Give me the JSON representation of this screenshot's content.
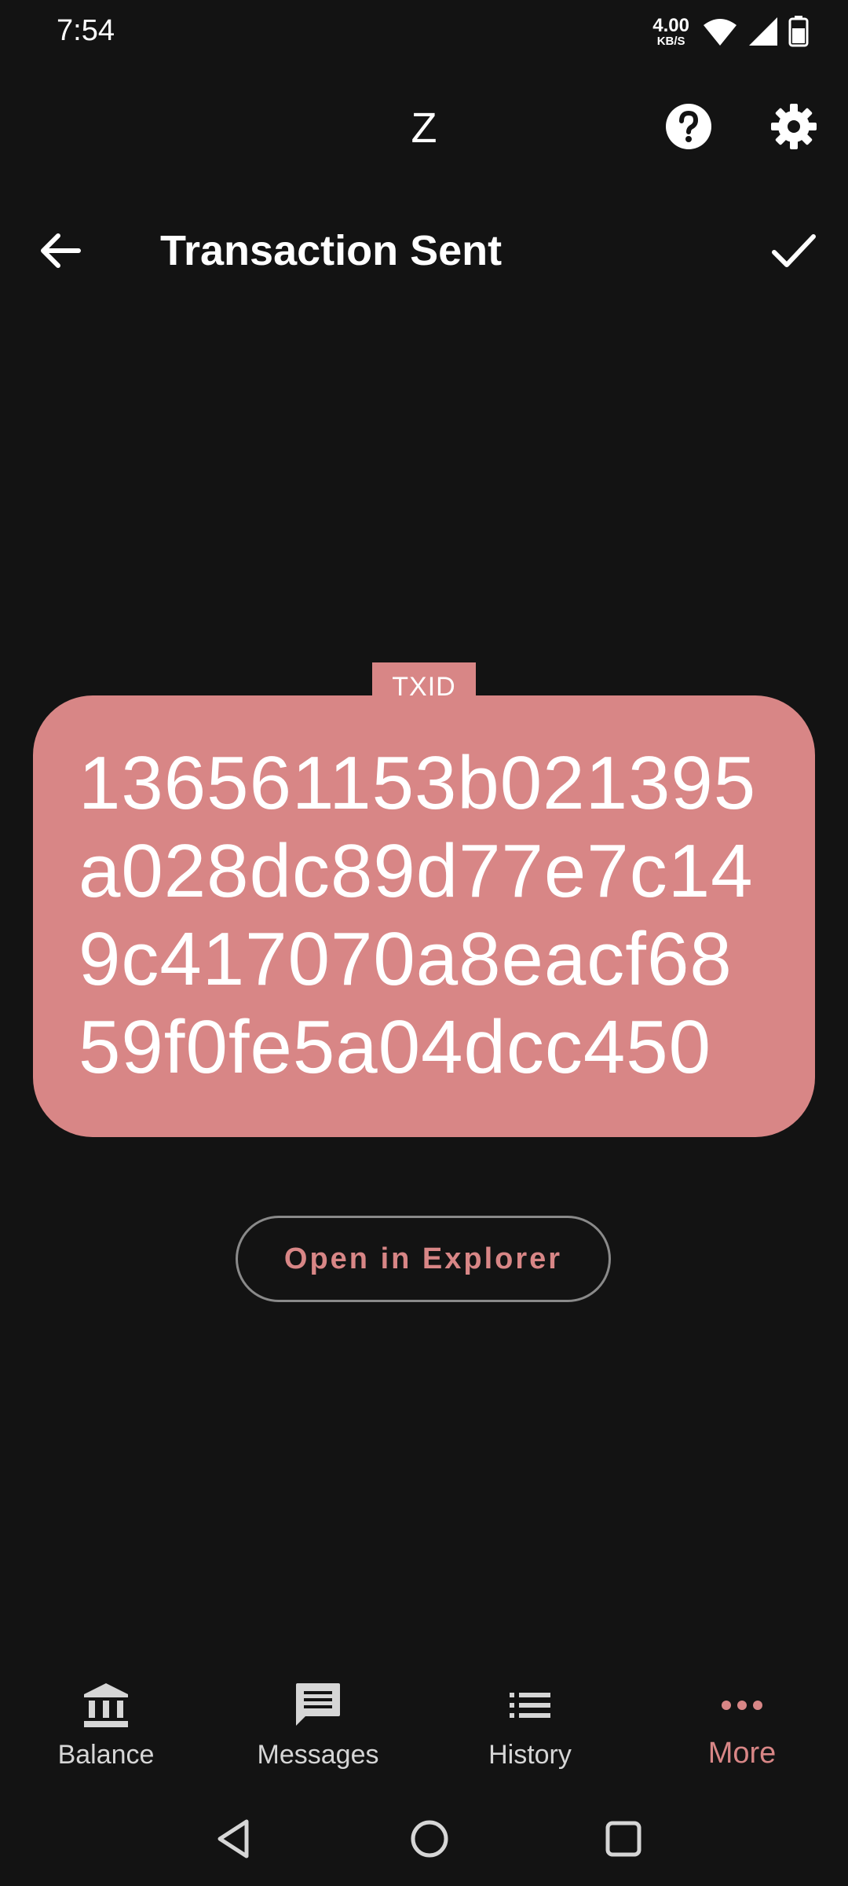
{
  "status_bar": {
    "time": "7:54",
    "net_speed_value": "4.00",
    "net_speed_unit": "KB/S"
  },
  "app_bar": {
    "title": "Z",
    "help_icon": "help-circle-icon",
    "settings_icon": "gear-icon"
  },
  "header": {
    "back_icon": "arrow-left-icon",
    "title": "Transaction Sent",
    "confirm_icon": "checkmark-icon"
  },
  "txid": {
    "label": "TXID",
    "lines": [
      "136561153b021395",
      "a028dc89d77e7c14",
      "9c417070a8eacf68",
      "59f0fe5a04dcc450"
    ]
  },
  "explorer_button": {
    "label": "Open in Explorer"
  },
  "bottom_nav": {
    "items": [
      {
        "label": "Balance",
        "icon": "bank-icon",
        "active": false
      },
      {
        "label": "Messages",
        "icon": "message-icon",
        "active": false
      },
      {
        "label": "History",
        "icon": "list-icon",
        "active": false
      },
      {
        "label": "More",
        "icon": "more-dots-icon",
        "active": true
      }
    ]
  },
  "colors": {
    "background": "#131313",
    "accent": "#d88686",
    "text": "#ffffff",
    "nav_inactive": "#d6d6d6"
  }
}
